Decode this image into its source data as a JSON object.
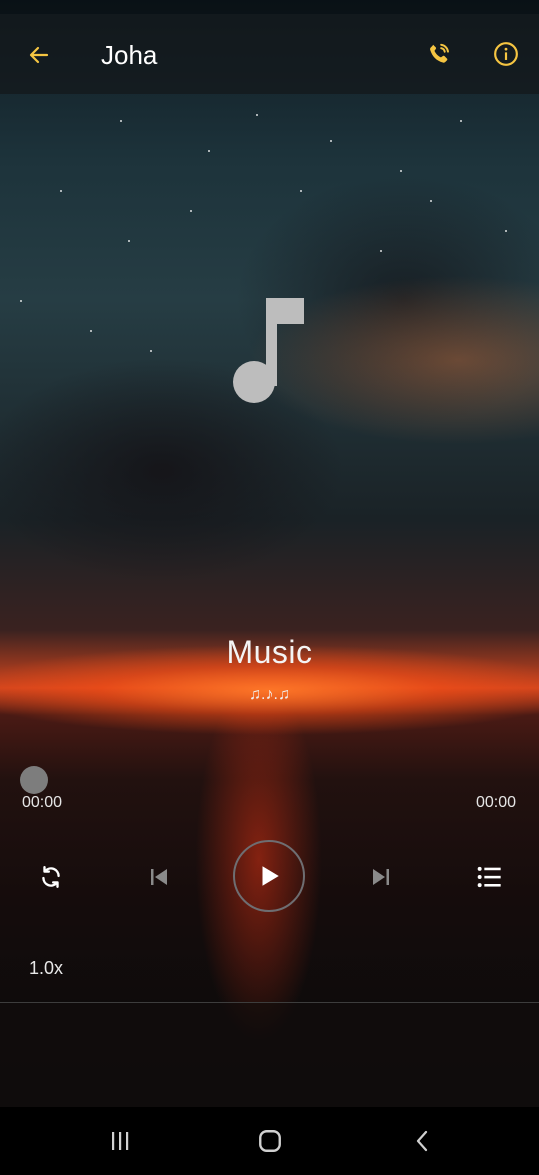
{
  "header": {
    "title": "Joha"
  },
  "icons": {
    "back": "arrow-left-icon",
    "call": "phone-icon",
    "info": "info-icon",
    "cover": "music-note-icon",
    "repeat": "repeat-icon",
    "previous": "skip-previous-icon",
    "play": "play-icon",
    "next": "skip-next-icon",
    "playlist": "playlist-icon",
    "nav_recent": "recent-apps-icon",
    "nav_home": "home-icon",
    "nav_back": "chevron-left-icon"
  },
  "player": {
    "song_title": "Music",
    "song_subtitle": "♫.♪.♫",
    "elapsed": "00:00",
    "duration": "00:00",
    "progress": 0,
    "speed": "1.0x"
  },
  "colors": {
    "accent": "#f5c542",
    "text": "#ffffff"
  }
}
